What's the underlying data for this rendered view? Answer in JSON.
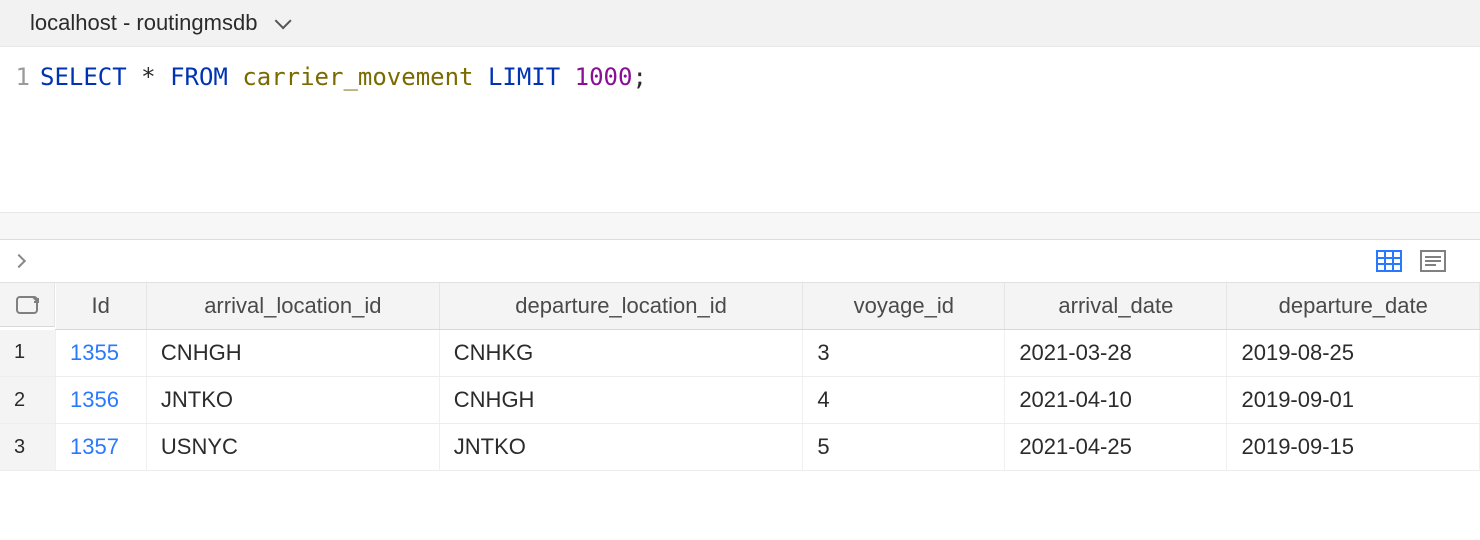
{
  "connection": {
    "label": "localhost - routingmsdb"
  },
  "editor": {
    "line_number": "1",
    "tokens": {
      "select": "SELECT",
      "star": "*",
      "from": "FROM",
      "table": "carrier_movement",
      "limit": "LIMIT",
      "number": "1000",
      "semicolon": ";"
    }
  },
  "results": {
    "columns": [
      "Id",
      "arrival_location_id",
      "departure_location_id",
      "voyage_id",
      "arrival_date",
      "departure_date"
    ],
    "rows": [
      {
        "n": "1",
        "id": "1355",
        "arrival_location_id": "CNHGH",
        "departure_location_id": "CNHKG",
        "voyage_id": "3",
        "arrival_date": "2021-03-28",
        "departure_date": "2019-08-25"
      },
      {
        "n": "2",
        "id": "1356",
        "arrival_location_id": "JNTKO",
        "departure_location_id": "CNHGH",
        "voyage_id": "4",
        "arrival_date": "2021-04-10",
        "departure_date": "2019-09-01"
      },
      {
        "n": "3",
        "id": "1357",
        "arrival_location_id": "USNYC",
        "departure_location_id": "JNTKO",
        "voyage_id": "5",
        "arrival_date": "2021-04-25",
        "departure_date": "2019-09-15"
      }
    ]
  }
}
